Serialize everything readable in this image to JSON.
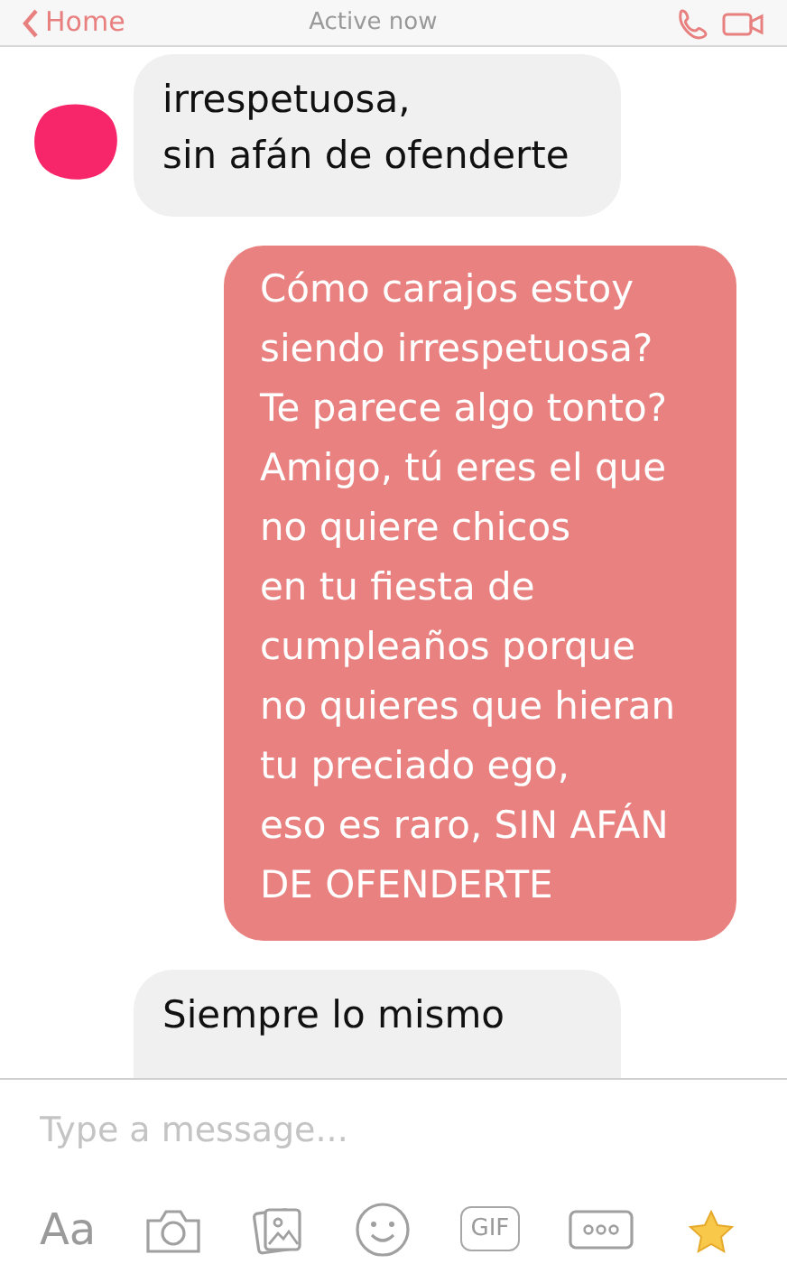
{
  "header": {
    "back_label": "Home",
    "status": "Active now"
  },
  "messages": [
    {
      "kind": "received",
      "avatar": true,
      "text": "irrespetuosa,\nsin afán de ofenderte"
    },
    {
      "kind": "sent",
      "avatar": false,
      "text": "Cómo carajos estoy\nsiendo irrespetuosa?\nTe parece algo tonto?\nAmigo, tú eres el que\nno quiere chicos\nen tu fiesta de\ncumpleaños porque\nno quieres que hieran\ntu preciado ego,\neso es raro, SIN AFÁN\nDE OFENDERTE"
    },
    {
      "kind": "received",
      "avatar": false,
      "text": "Siempre lo mismo"
    }
  ],
  "composer": {
    "placeholder": "Type a message...",
    "toolbar": [
      {
        "kind": "text",
        "label": "Aa"
      },
      {
        "kind": "camera"
      },
      {
        "kind": "gallery"
      },
      {
        "kind": "emoji"
      },
      {
        "kind": "gif",
        "label": "GIF"
      },
      {
        "kind": "more"
      },
      {
        "kind": "star"
      }
    ]
  }
}
